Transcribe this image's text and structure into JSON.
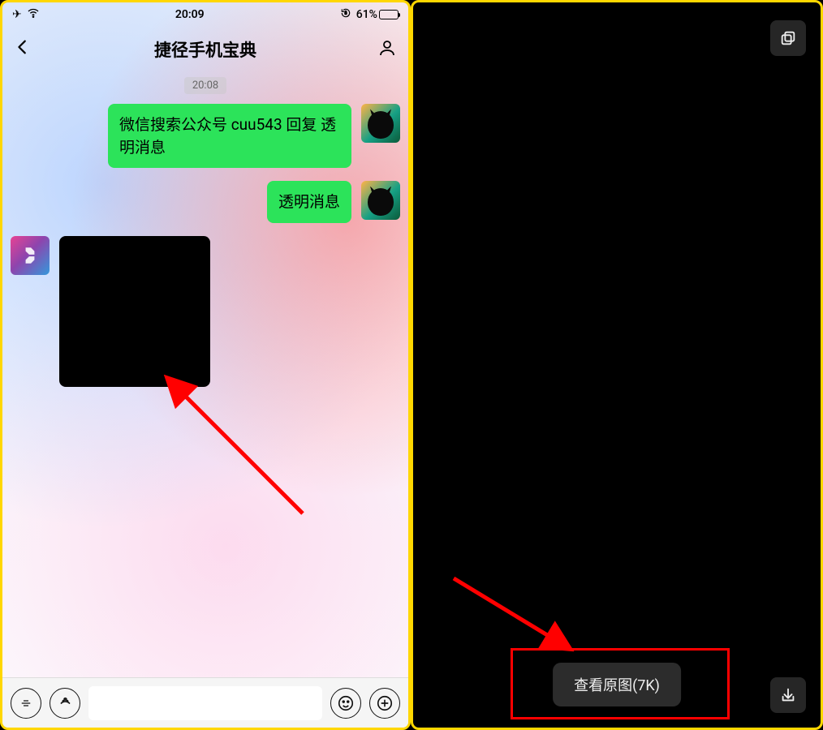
{
  "left": {
    "status": {
      "time": "20:09",
      "battery_pct": "61%"
    },
    "nav": {
      "title": "捷径手机宝典"
    },
    "timestamp": "20:08",
    "messages": {
      "out1": "微信搜索公众号 cuu543 回复 透明消息",
      "out2": "透明消息"
    },
    "input": {
      "placeholder": ""
    }
  },
  "right": {
    "view_original": "查看原图(7K)"
  }
}
